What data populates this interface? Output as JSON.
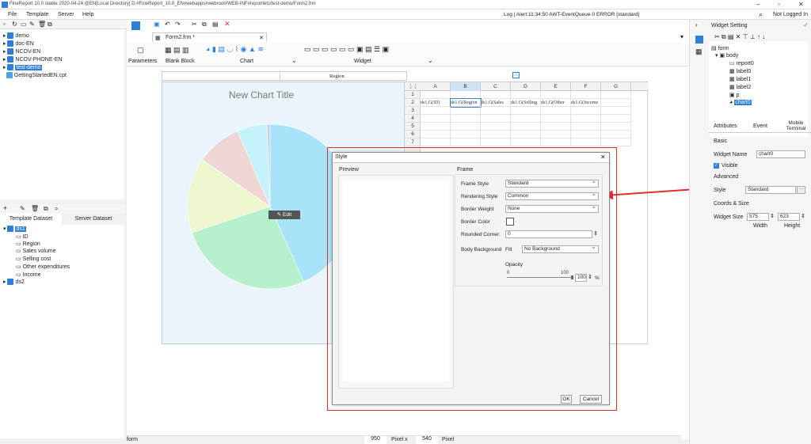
{
  "app": {
    "title": "FineReport 10.0 stable 2020-04-24 @EN[Local Directory]   D:#FineReport_10.0_EN#webapps#webroot#WEB-INF#reportlets/test-demo/Form2.frm"
  },
  "menu": {
    "file": "File",
    "template": "Template",
    "server": "Server",
    "help": "Help",
    "log": "Log | Alert:11:34:50 AWT-EventQueue-0 ERROR [standard]",
    "login": "Not Logged In"
  },
  "tree": {
    "items": [
      "demo",
      "doc-EN",
      "NCOV-EN",
      "NCOV-PHONE-EN",
      "test-demo",
      "GettingStartedEN.cpt"
    ]
  },
  "dataset": {
    "tab1": "Template Dataset",
    "tab2": "Server Dataset",
    "ds1": "ds1",
    "fields": [
      "ID",
      "Region",
      "Sales volume",
      "Selling cost",
      "Other expenditures",
      "Income"
    ],
    "ds2": "ds2"
  },
  "editor": {
    "tab": "Form2.frm *",
    "parameters": "Parameters",
    "blank_block": "Blank Block",
    "chart": "Chart",
    "widget": "Widget"
  },
  "chart": {
    "title": "New Chart Title",
    "edit": "Edit"
  },
  "chart_data": {
    "type": "pie",
    "title": "New Chart Title",
    "categories": [
      "",
      "",
      "",
      "",
      "",
      ""
    ],
    "values": [
      44,
      27,
      15,
      9,
      6,
      0.6
    ],
    "colors": [
      "#a9e3f7",
      "#b7f0cc",
      "#eef6cf",
      "#efd6d4",
      "#c4f2fb",
      "#c9d0e6"
    ]
  },
  "sheet": {
    "header_title": "Region",
    "cols": [
      "A",
      "B",
      "C",
      "D",
      "E",
      "F",
      "G"
    ],
    "rows": [
      "1",
      "2",
      "3",
      "4",
      "5",
      "6",
      "7"
    ],
    "row2": [
      "ds1.G(ID)",
      "ds1.G(Region",
      "ds1.G(Sales",
      "ds1.G(Selling",
      "ds1.G(Other",
      "ds1.G(Income",
      ""
    ]
  },
  "status": {
    "left": "form",
    "w": "950",
    "pixel_x": "Pixel  x",
    "h": "540",
    "pixel": "Pixel"
  },
  "widget_setting": {
    "title": "Widget Setting",
    "root": "form",
    "body": "body",
    "nodes": [
      "report0",
      "label0",
      "label1",
      "label2",
      "p",
      "chart0"
    ],
    "tabs": [
      "Attributes",
      "Event",
      "Mobile Terminal"
    ],
    "basic": "Basic",
    "widget_name_label": "Widget Name",
    "widget_name": "chart0",
    "visible": "Visible",
    "advanced": "Advanced",
    "style_label": "Style",
    "style_value": "Standard",
    "coords": "Coords & Size",
    "size_label": "Widget Size",
    "width": "575",
    "height": "623",
    "width_label": "Width",
    "height_label": "Height"
  },
  "dialog": {
    "title": "Style",
    "preview": "Preview",
    "frame": "Frame",
    "frame_style_label": "Frame Style",
    "frame_style": "Standard",
    "rendering_label": "Rendering Style",
    "rendering": "Common",
    "border_weight_label": "Border Weight",
    "border_weight": "None",
    "border_color_label": "Border Color",
    "rounded_label": "Rounded Corner:",
    "rounded": "0",
    "body_bg_label": "Body Background",
    "fill": "Fill",
    "body_bg": "No Background",
    "opacity_label": "Opacity",
    "opacity_min": "0",
    "opacity_max": "100",
    "opacity_val": "100",
    "percent": "%",
    "ok": "OK",
    "cancel": "Cancel"
  },
  "colors": {
    "accent": "#2f7fd9",
    "highlight": "#e0302c"
  }
}
